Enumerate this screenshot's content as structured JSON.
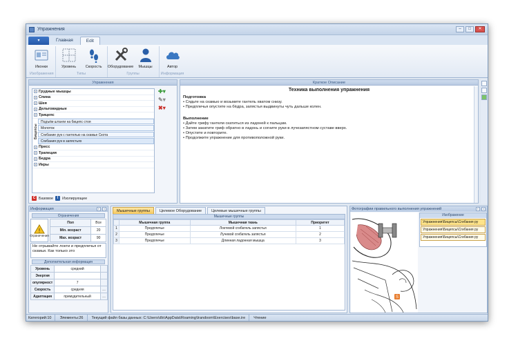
{
  "window": {
    "title": "Упражнения"
  },
  "ribbon": {
    "tabs": [
      "Главная",
      "Edit"
    ],
    "groups": [
      {
        "label": "Изображения",
        "buttons": [
          {
            "label": "Иконки",
            "icon": "id-card-icon"
          }
        ]
      },
      {
        "label": "Типы",
        "buttons": [
          {
            "label": "Уровень",
            "icon": "level-grid-icon"
          },
          {
            "label": "Скорость",
            "icon": "footsteps-icon"
          }
        ]
      },
      {
        "label": "Группы",
        "buttons": [
          {
            "label": "Оборудование",
            "icon": "tools-icon"
          },
          {
            "label": "Мышцы",
            "icon": "person-icon"
          }
        ]
      },
      {
        "label": "Информация",
        "buttons": [
          {
            "label": "Автор",
            "icon": "cloud-icon"
          }
        ]
      }
    ]
  },
  "exercises": {
    "header": "Упражнения",
    "groups_top": [
      "Грудные мышцы",
      "Спина",
      "Шея",
      "Дельтовидные",
      "Трицепс"
    ],
    "sub_label": "Бицепсы",
    "sub_items": [
      "Подъём штанги на бицепс стоя",
      "Молоток",
      "Сгибание рук с гантелью на скамье Скота",
      "Сгибания рук в запястьях"
    ],
    "groups_bottom": [
      "Пресс",
      "Трапеция",
      "Бедра",
      "Икры"
    ],
    "legend": {
      "base": "Базовое",
      "isolating": "Изолирующее",
      "base_letter": "C",
      "isolating_letter": "I"
    }
  },
  "description": {
    "header": "Краткое Описание",
    "title": "Техника выполнения упражнения",
    "prep_title": "Подготовка",
    "prep": [
      "Сядьте на скамью и возьмите гантель хватом снизу.",
      "Предплечья опустите на бёдра, запястья выдвинуты чуть дальше колен."
    ],
    "exec_title": "Выполнение",
    "exec": [
      "Дайте грифу гантели скатиться из ладоней к пальцам.",
      "Затем закатите гриф обратно в ладонь и согните руки в лучезапястном суставе вверх.",
      "Опустите и повторите.",
      "Продолжите упражнение для противоположной руки."
    ]
  },
  "info": {
    "header": "Информация",
    "limits_header": "Ограничения",
    "warn_label": "Ограничения",
    "limits": [
      {
        "k": "Пол",
        "v": "Все"
      },
      {
        "k": "Min. возраст",
        "v": "20"
      },
      {
        "k": "Max. возраст",
        "v": "90"
      }
    ],
    "note": "Не отрывайте локти и предплечья от скамьи. Как только это",
    "extra_header": "Дополнительная информация",
    "extra": [
      {
        "k": "Уровень",
        "v": "средний"
      },
      {
        "k": "Энергия",
        "v": ""
      },
      {
        "k": "опулярност",
        "v": "7"
      },
      {
        "k": "Скорость",
        "v": "средняя"
      },
      {
        "k": "Адаптация",
        "v": "примудительный"
      }
    ]
  },
  "muscles": {
    "tabs": [
      "Мышечные группы",
      "Целевое Оборудование",
      "Целевые мышечные группы"
    ],
    "grid_header": "Мышечные группы",
    "columns": [
      "Мышечная группа",
      "Мышечная ткань",
      "Приоритет"
    ],
    "rows": [
      {
        "n": "1",
        "group": "Предплечье",
        "tissue": "Локтевой сгибатель запястья",
        "priority": "1"
      },
      {
        "n": "2",
        "group": "Предплечье",
        "tissue": "Лучевой сгибатель запястья",
        "priority": "2"
      },
      {
        "n": "3",
        "group": "Предплечье",
        "tissue": "Длинная ладонная мышца",
        "priority": "3"
      }
    ]
  },
  "photos": {
    "header": "Фотографии правильного выполнения упражнений",
    "list_header": "Изображение",
    "items": [
      "Упражнения\\Бицепсы\\Сгибания ру",
      "Упражнения\\Бицепсы\\Сгибания ру",
      "Упражнения\\Бицепсы\\Сгибания ру"
    ],
    "badge": "S"
  },
  "status": {
    "categories": "Категорий:10",
    "elements": "Элементы:26",
    "file": "Текущий файл базы данных: C:\\Users\\dlx\\AppData\\Roaming\\Irandoom\\Exercises\\base.ire",
    "mode": "Чтение"
  }
}
